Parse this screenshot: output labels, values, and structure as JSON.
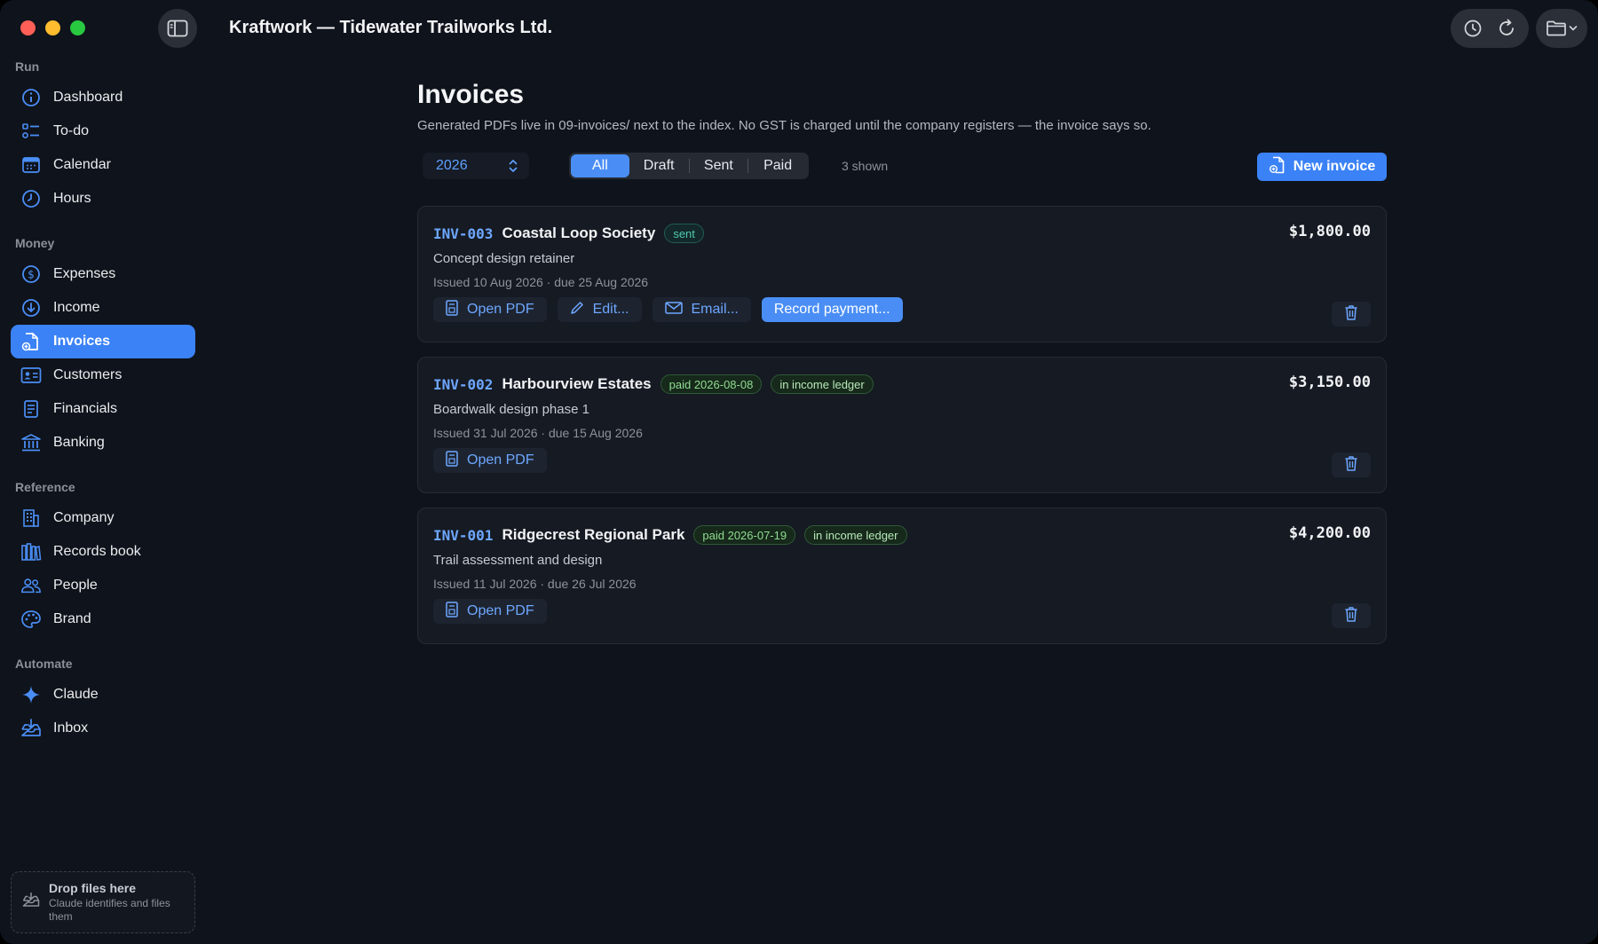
{
  "app": {
    "title": "Kraftwork — Tidewater Trailworks Ltd."
  },
  "sidebar": {
    "sections": [
      {
        "label": "Run",
        "items": [
          {
            "label": "Dashboard",
            "icon": "info-icon"
          },
          {
            "label": "To-do",
            "icon": "checklist-icon"
          },
          {
            "label": "Calendar",
            "icon": "calendar-icon"
          },
          {
            "label": "Hours",
            "icon": "clock-icon"
          }
        ]
      },
      {
        "label": "Money",
        "items": [
          {
            "label": "Expenses",
            "icon": "dollar-icon"
          },
          {
            "label": "Income",
            "icon": "download-circle-icon"
          },
          {
            "label": "Invoices",
            "icon": "invoice-icon",
            "active": true
          },
          {
            "label": "Customers",
            "icon": "contact-card-icon"
          },
          {
            "label": "Financials",
            "icon": "document-lines-icon"
          },
          {
            "label": "Banking",
            "icon": "bank-icon"
          }
        ]
      },
      {
        "label": "Reference",
        "items": [
          {
            "label": "Company",
            "icon": "building-icon"
          },
          {
            "label": "Records book",
            "icon": "books-icon"
          },
          {
            "label": "People",
            "icon": "people-icon"
          },
          {
            "label": "Brand",
            "icon": "palette-icon"
          }
        ]
      },
      {
        "label": "Automate",
        "items": [
          {
            "label": "Claude",
            "icon": "sparkle-icon"
          },
          {
            "label": "Inbox",
            "icon": "inbox-icon"
          }
        ]
      }
    ],
    "dropzone": {
      "title": "Drop files here",
      "subtitle": "Claude identifies and files them"
    }
  },
  "page": {
    "title": "Invoices",
    "subtitle": "Generated PDFs live in 09-invoices/ next to the index. No GST is charged until the company registers — the invoice says so.",
    "year": "2026",
    "filters": [
      "All",
      "Draft",
      "Sent",
      "Paid"
    ],
    "active_filter": "All",
    "shown": "3 shown",
    "new_button": "New invoice"
  },
  "invoices": [
    {
      "id": "INV-003",
      "customer": "Coastal Loop Society",
      "badges": [
        {
          "text": "sent",
          "kind": "sent"
        }
      ],
      "amount": "$1,800.00",
      "description": "Concept design retainer",
      "dates": "Issued 10 Aug 2026  · due 25 Aug 2026",
      "actions": {
        "open_pdf": "Open PDF",
        "edit": "Edit...",
        "email": "Email...",
        "record": "Record payment..."
      }
    },
    {
      "id": "INV-002",
      "customer": "Harbourview Estates",
      "badges": [
        {
          "text": "paid 2026-08-08",
          "kind": "paid"
        },
        {
          "text": "in income ledger",
          "kind": "ledger"
        }
      ],
      "amount": "$3,150.00",
      "description": "Boardwalk design phase 1",
      "dates": "Issued 31 Jul 2026  · due 15 Aug 2026",
      "actions": {
        "open_pdf": "Open PDF"
      }
    },
    {
      "id": "INV-001",
      "customer": "Ridgecrest Regional Park",
      "badges": [
        {
          "text": "paid 2026-07-19",
          "kind": "paid"
        },
        {
          "text": "in income ledger",
          "kind": "ledger"
        }
      ],
      "amount": "$4,200.00",
      "description": "Trail assessment and design",
      "dates": "Issued 11 Jul 2026  · due 26 Jul 2026",
      "actions": {
        "open_pdf": "Open PDF"
      }
    }
  ],
  "colors": {
    "accent": "#3b82f6",
    "background": "#0f131b",
    "card": "#151a23",
    "link": "#6ea7ff"
  }
}
